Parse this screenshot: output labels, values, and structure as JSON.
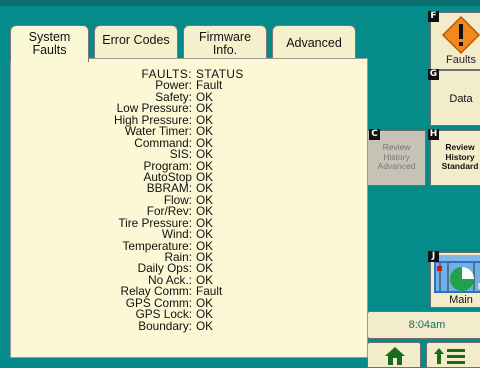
{
  "tabs": [
    {
      "label": "System\nFaults"
    },
    {
      "label": "Error Codes"
    },
    {
      "label": "Firmware\nInfo."
    },
    {
      "label": "Advanced"
    }
  ],
  "faults": {
    "header_label": "FAULTS:",
    "header_value": "STATUS",
    "rows": [
      {
        "label": "Power:",
        "value": "Fault"
      },
      {
        "label": "Safety:",
        "value": "OK"
      },
      {
        "label": "Low Pressure:",
        "value": "OK"
      },
      {
        "label": "High Pressure:",
        "value": "OK"
      },
      {
        "label": "Water Timer:",
        "value": "OK"
      },
      {
        "label": "Command:",
        "value": "OK"
      },
      {
        "label": "SIS:",
        "value": "OK"
      },
      {
        "label": "Program:",
        "value": "OK"
      },
      {
        "label": "AutoStop",
        "value": "OK"
      },
      {
        "label": "BBRAM:",
        "value": "OK"
      },
      {
        "label": "Flow:",
        "value": "OK"
      },
      {
        "label": "For/Rev:",
        "value": "OK"
      },
      {
        "label": "Tire Pressure:",
        "value": "OK"
      },
      {
        "label": "Wind:",
        "value": "OK"
      },
      {
        "label": "Temperature:",
        "value": "OK"
      },
      {
        "label": "Rain:",
        "value": "OK"
      },
      {
        "label": "Daily Ops:",
        "value": "OK"
      },
      {
        "label": "No Ack.:",
        "value": "OK"
      },
      {
        "label": "Relay Comm:",
        "value": "Fault"
      },
      {
        "label": "GPS Comm:",
        "value": "OK"
      },
      {
        "label": "GPS Lock:",
        "value": "OK"
      },
      {
        "label": "Boundary:",
        "value": "OK"
      }
    ]
  },
  "side_buttons": {
    "faults": {
      "letter": "F",
      "label": "Faults"
    },
    "data": {
      "letter": "G",
      "label": "Data"
    },
    "review_advanced": {
      "letter": "C",
      "label_line1": "Review",
      "label_line2": "History",
      "label_line3": "Advanced"
    },
    "review_standard": {
      "letter": "H",
      "label_line1": "Review",
      "label_line2": "History",
      "label_line3": "Standard"
    },
    "main": {
      "letter": "J",
      "label": "Main"
    }
  },
  "clock": {
    "time": "8:04am"
  },
  "colors": {
    "background": "#058b8a",
    "panel": "#fcf8d6",
    "button": "#f3eccb",
    "fault_accent": "#f08a1c"
  }
}
